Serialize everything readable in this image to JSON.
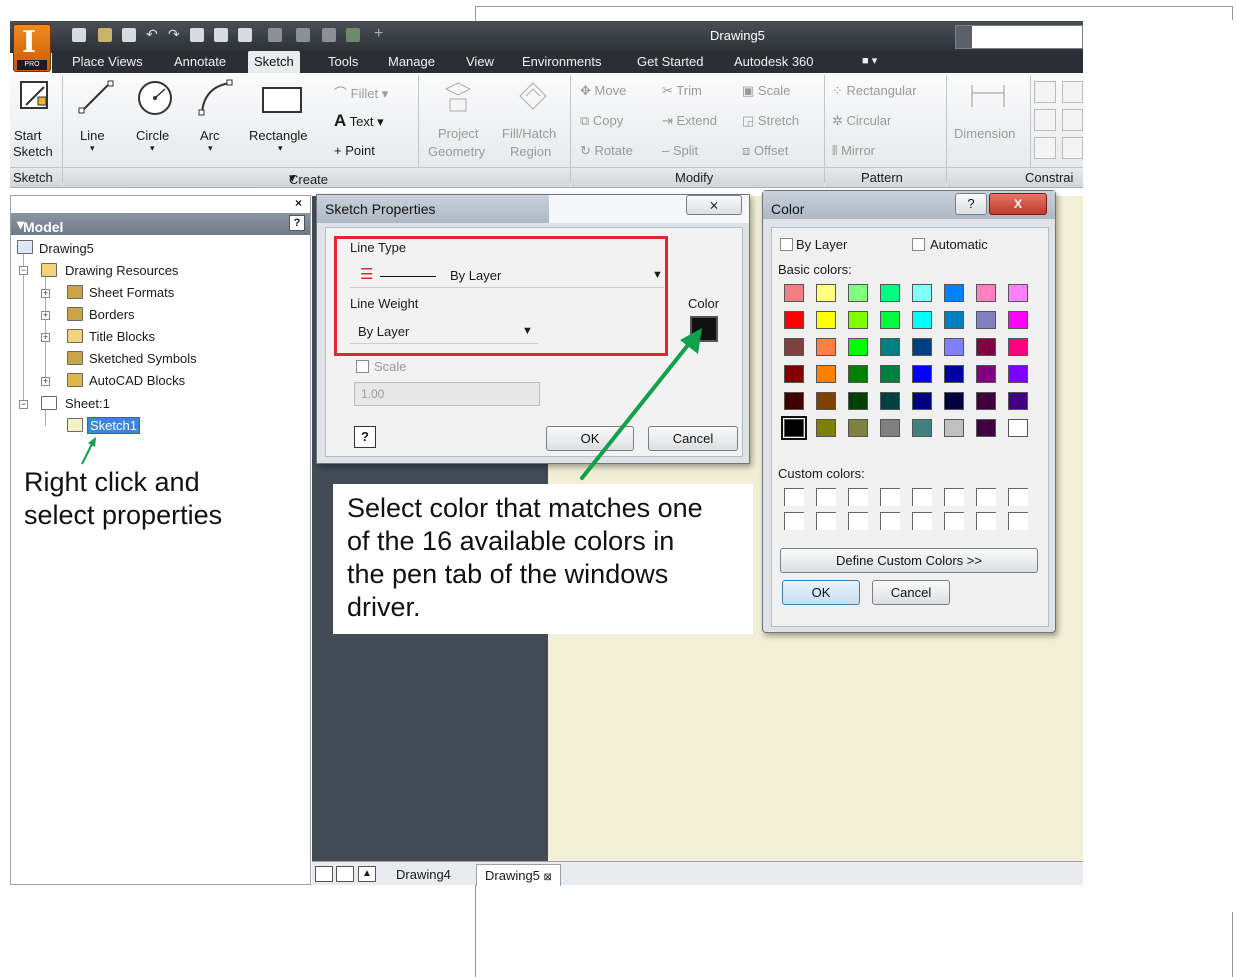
{
  "window": {
    "title": "Drawing5"
  },
  "app": {
    "logo_letter": "I",
    "logo_badge": "PRO"
  },
  "menu": {
    "tabs": [
      "Place Views",
      "Annotate",
      "Sketch",
      "Tools",
      "Manage",
      "View",
      "Environments",
      "Get Started",
      "Autodesk 360"
    ],
    "active": "Sketch"
  },
  "ribbon": {
    "start_sketch": [
      "Start",
      "Sketch"
    ],
    "line": "Line",
    "circle": "Circle",
    "arc": "Arc",
    "rectangle": "Rectangle",
    "fillet": "Fillet",
    "text": "Text",
    "point": "Point",
    "project_geometry": [
      "Project",
      "Geometry"
    ],
    "fill_hatch": [
      "Fill/Hatch",
      "Region"
    ],
    "move": "Move",
    "copy": "Copy",
    "rotate": "Rotate",
    "trim": "Trim",
    "extend": "Extend",
    "split": "Split",
    "scale": "Scale",
    "stretch": "Stretch",
    "offset": "Offset",
    "rectangular": "Rectangular",
    "circular": "Circular",
    "mirror": "Mirror",
    "dimension": "Dimension",
    "panels": {
      "sketch": "Sketch",
      "create": "Create",
      "modify": "Modify",
      "pattern": "Pattern",
      "constrain": "Constrai"
    }
  },
  "browser": {
    "title": "Model",
    "help": "?",
    "close": "×",
    "items": [
      "Drawing5",
      "Drawing Resources",
      "Sheet Formats",
      "Borders",
      "Title Blocks",
      "Sketched Symbols",
      "AutoCAD Blocks",
      "Sheet:1",
      "Sketch1"
    ]
  },
  "annotations": {
    "right_click": [
      "Right click and",
      "select properties"
    ],
    "select_color": [
      "Select color that matches one",
      "of the 16 available colors in",
      "the pen tab of the windows",
      "driver."
    ]
  },
  "sketch_properties": {
    "title": "Sketch Properties",
    "close": "⨯",
    "line_type_label": "Line Type",
    "line_type_value": "By Layer",
    "line_weight_label": "Line Weight",
    "line_weight_value": "By Layer",
    "color_label": "Color",
    "scale_label": "Scale",
    "scale_value": "1.00",
    "help": "?",
    "ok": "OK",
    "cancel": "Cancel"
  },
  "color_dialog": {
    "title": "Color",
    "help": "?",
    "close": "X",
    "by_layer": "By Layer",
    "automatic": "Automatic",
    "basic_label": "Basic colors:",
    "custom_label": "Custom colors:",
    "define_custom": "Define Custom Colors >>",
    "ok": "OK",
    "cancel": "Cancel",
    "basic_colors": [
      [
        "#f08080",
        "#ffff80",
        "#80ff80",
        "#00ff80",
        "#80ffff",
        "#0080ff",
        "#ff80c0",
        "#ff80ff"
      ],
      [
        "#ff0000",
        "#ffff00",
        "#80ff00",
        "#00ff40",
        "#00ffff",
        "#0080c0",
        "#8080c0",
        "#ff00ff"
      ],
      [
        "#804040",
        "#ff8040",
        "#00ff00",
        "#008080",
        "#004080",
        "#8080ff",
        "#800040",
        "#ff0080"
      ],
      [
        "#800000",
        "#ff8000",
        "#008000",
        "#008040",
        "#0000ff",
        "#0000a0",
        "#800080",
        "#8000ff"
      ],
      [
        "#400000",
        "#804000",
        "#004000",
        "#004040",
        "#000080",
        "#000040",
        "#400040",
        "#400080"
      ],
      [
        "#000000",
        "#808000",
        "#808040",
        "#808080",
        "#408080",
        "#c0c0c0",
        "#400040",
        "#ffffff"
      ]
    ]
  },
  "doc_tabs": {
    "tabs": [
      "Drawing4",
      "Drawing5"
    ],
    "close": "⊠"
  },
  "colors": {
    "accent_red": "#e0262e",
    "arrow_green": "#12a04a",
    "titlebar": "#2b2f35"
  }
}
